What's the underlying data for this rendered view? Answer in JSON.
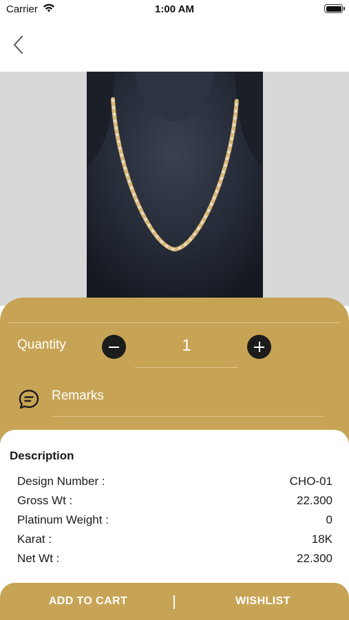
{
  "status_bar": {
    "carrier": "Carrier",
    "time": "1:00 AM"
  },
  "nav": {
    "back_icon": "chevron-left-icon"
  },
  "colors": {
    "gold": "#c7a455",
    "image_background": "#d8d8d8",
    "dark_button": "#1c1c1c"
  },
  "product": {
    "image": "gold and diamond link chain necklace on black display bust"
  },
  "quantity": {
    "label": "Quantity",
    "value": "1",
    "minus_icon": "minus-icon",
    "plus_icon": "plus-icon"
  },
  "remarks": {
    "icon": "chat-bubble-icon",
    "placeholder": "Remarks"
  },
  "description": {
    "title": "Description",
    "rows": [
      {
        "label": "Design Number :",
        "value": "CHO-01"
      },
      {
        "label": "Gross Wt :",
        "value": "22.300"
      },
      {
        "label": "Platinum Weight :",
        "value": "0"
      },
      {
        "label": "Karat :",
        "value": "18K"
      },
      {
        "label": "Net Wt :",
        "value": "22.300"
      }
    ]
  },
  "actions": {
    "add_to_cart": "ADD TO CART",
    "divider": "|",
    "wishlist": "WISHLIST"
  }
}
